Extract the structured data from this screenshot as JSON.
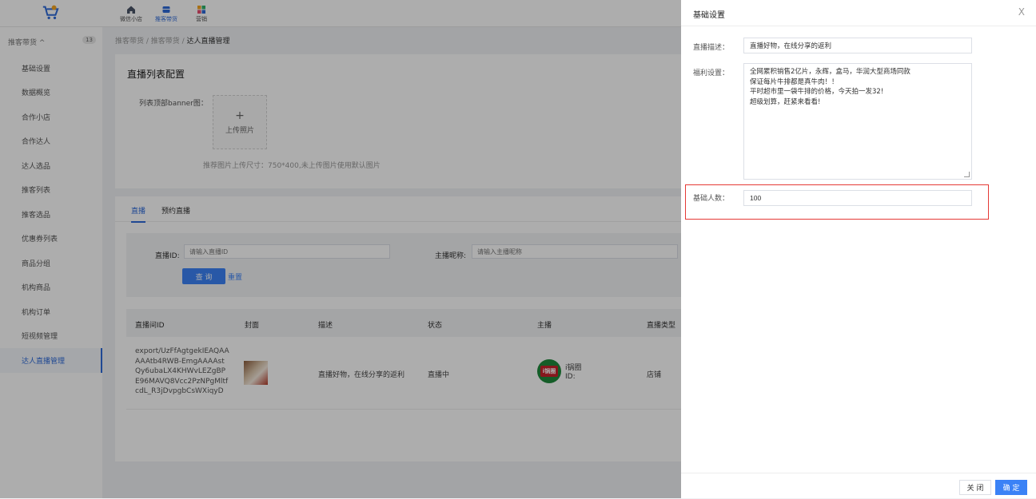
{
  "topnav": [
    {
      "label": "微信小店",
      "icon": "home-icon"
    },
    {
      "label": "推客带货",
      "icon": "box-icon"
    },
    {
      "label": "营销",
      "icon": "grid-icon"
    }
  ],
  "sidebar": {
    "group_label": "推客带货 ^",
    "group_count": "13",
    "items": [
      {
        "label": "基础设置"
      },
      {
        "label": "数据概览"
      },
      {
        "label": "合作小店"
      },
      {
        "label": "合作达人"
      },
      {
        "label": "达人选品"
      },
      {
        "label": "推客列表"
      },
      {
        "label": "推客选品"
      },
      {
        "label": "优惠券列表"
      },
      {
        "label": "商品分组"
      },
      {
        "label": "机构商品"
      },
      {
        "label": "机构订单"
      },
      {
        "label": "短视频管理"
      },
      {
        "label": "达人直播管理"
      }
    ]
  },
  "breadcrumb": {
    "part1": "推客带货 / 推客带货 / ",
    "current": "达人直播管理"
  },
  "config": {
    "title": "直播列表配置",
    "banner_label": "列表顶部banner图：",
    "upload_plus": "+",
    "upload_text": "上传照片",
    "hint": "推荐图片上传尺寸：750*400,未上传图片使用默认图片"
  },
  "tabs": [
    "直播",
    "预约直播"
  ],
  "filter": {
    "id_label": "直播ID:",
    "id_placeholder": "请输入直播ID",
    "nick_label": "主播昵称:",
    "nick_placeholder": "请输入主播昵称",
    "query": "查 询",
    "reset": "重置"
  },
  "table": {
    "headers": [
      "直播间ID",
      "封面",
      "描述",
      "状态",
      "主播",
      "直播类型"
    ],
    "row": {
      "id": "export/UzFfAgtgekIEAQAAAAAtb4RWB-EmgAAAAstQy6ubaLX4KHWvLEZgBPE96MAVQ8Vcc2PzNPgMltfcdL_R3jDvpgbCsWXiqyD",
      "description": "直播好物，在线分享的返利",
      "status": "直播中",
      "anchor_name": "i锅圈",
      "anchor_id": "ID:",
      "type": "店铺",
      "avatar_text": "i锅圈"
    }
  },
  "drawer": {
    "title": "基础设置",
    "close_icon": "X",
    "desc_label": "直播描述：",
    "desc_value": "直播好物，在线分享的返利",
    "welfare_label": "福利设置：",
    "welfare_lines": [
      "全网累积销售2亿片，永辉，盒马，华润大型商场同款",
      "保证每片牛排都是真牛肉！！",
      "平时超市里一袋牛排的价格，今天拍一发32!",
      "超级划算，赶紧来看看!"
    ],
    "base_label": "基础人数：",
    "base_value": "100",
    "btn_close": "关 闭",
    "btn_ok": "确 定"
  },
  "colors": {
    "accent": "#3b82f6",
    "highlight": "#e53935"
  }
}
